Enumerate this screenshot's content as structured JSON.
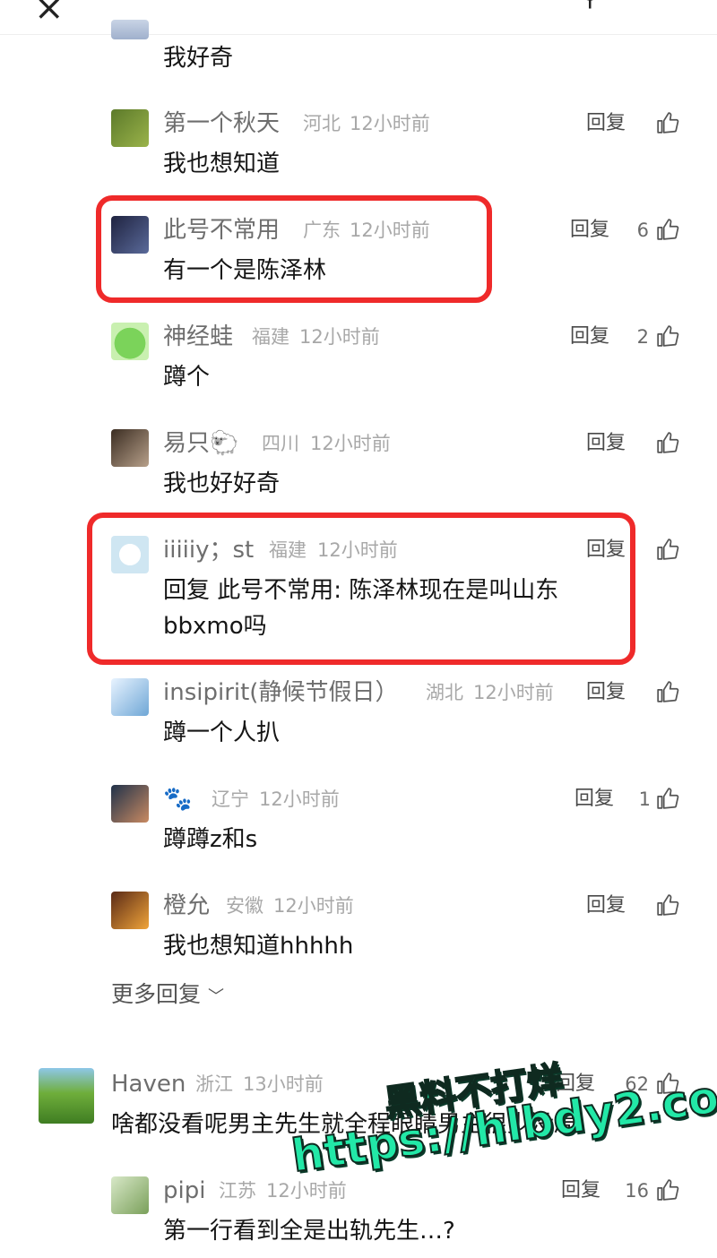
{
  "top_fragment": {
    "text": "我好奇"
  },
  "comments": [
    {
      "name": "第一个秋天",
      "location": "河北",
      "time": "12小时前",
      "reply": "回复",
      "likes": "",
      "text": "我也想知道"
    },
    {
      "name": "此号不常用",
      "location": "广东",
      "time": "12小时前",
      "reply": "回复",
      "likes": "6",
      "text": "有一个是陈泽林"
    },
    {
      "name": "神经蛙",
      "location": "福建",
      "time": "12小时前",
      "reply": "回复",
      "likes": "2",
      "text": "蹲个"
    },
    {
      "name": "易只🐑",
      "location": "四川",
      "time": "12小时前",
      "reply": "回复",
      "likes": "",
      "text": "我也好好奇"
    },
    {
      "name": "iiiiiy；st",
      "location": "福建",
      "time": "12小时前",
      "reply": "回复",
      "likes": "",
      "text": "回复 此号不常用: 陈泽林现在是叫山东",
      "text2": "bbxmo吗"
    },
    {
      "name": "insipirit(静候节假日）",
      "location": "湖北",
      "time": "12小时前",
      "reply": "回复",
      "likes": "",
      "text": "蹲一个人扒"
    },
    {
      "name": "🐾",
      "location": "辽宁",
      "time": "12小时前",
      "reply": "回复",
      "likes": "1",
      "text": "蹲蹲z和s"
    },
    {
      "name": "橙允",
      "location": "安徽",
      "time": "12小时前",
      "reply": "回复",
      "likes": "",
      "text": "我也想知道hhhhh"
    },
    {
      "name": "Haven",
      "location": "浙江",
      "time": "13小时前",
      "reply": "回复",
      "likes": "62",
      "text": "啥都没看呢男主先生就全程眼睛男主很少没局"
    },
    {
      "name": "pipi",
      "location": "江苏",
      "time": "12小时前",
      "reply": "回复",
      "likes": "16",
      "text": "第一行看到全是出轨先生…?"
    }
  ],
  "more_replies": "更多回复",
  "watermark": {
    "line1": "黑料不打烊",
    "line2": "https://hlbdy2.com"
  },
  "colors": {
    "highlight": "#ef2a2a",
    "watermark": "#22e8a7"
  }
}
